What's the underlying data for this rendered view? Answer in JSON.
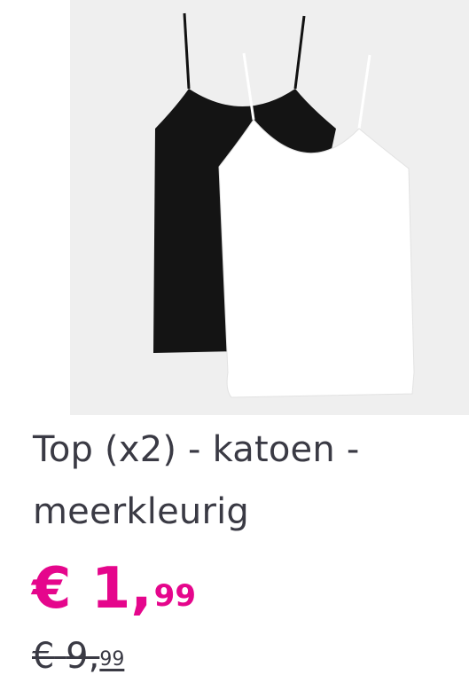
{
  "product": {
    "image_alt": "Top (x2) - katoen - meerkleurig",
    "title_line1": "Top (x2) - katoen -",
    "title_line2": "meerkleurig",
    "price": {
      "currency": "€",
      "whole": "1,",
      "cents": "99",
      "color": "#e5068c"
    },
    "old_price": {
      "currency": "€",
      "whole": "9,",
      "cents": "99"
    }
  }
}
